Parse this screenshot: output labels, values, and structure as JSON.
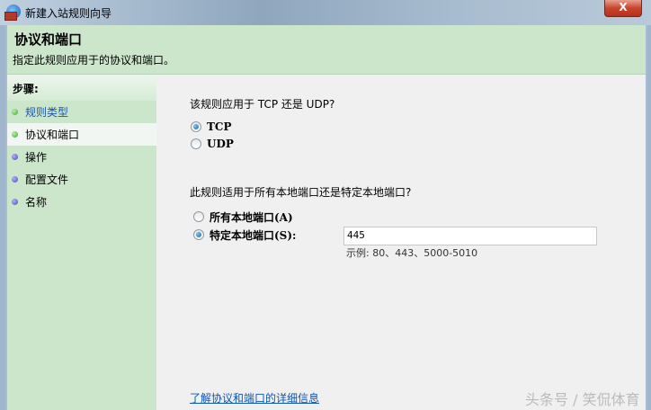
{
  "window": {
    "title": "新建入站规则向导",
    "close_label": "X"
  },
  "header": {
    "title": "协议和端口",
    "subtitle": "指定此规则应用于的协议和端口。"
  },
  "sidebar": {
    "heading": "步骤:",
    "items": [
      {
        "label": "规则类型",
        "state": "done"
      },
      {
        "label": "协议和端口",
        "state": "current"
      },
      {
        "label": "操作"
      },
      {
        "label": "配置文件"
      },
      {
        "label": "名称"
      }
    ]
  },
  "main": {
    "protocol_question": "该规则应用于 TCP 还是 UDP?",
    "protocol_options": [
      {
        "label": "TCP",
        "selected": true
      },
      {
        "label": "UDP",
        "selected": false
      }
    ],
    "port_question": "此规则适用于所有本地端口还是特定本地端口?",
    "port_options": [
      {
        "label": "所有本地端口(A)",
        "selected": false
      },
      {
        "label": "特定本地端口(S):",
        "selected": true
      }
    ],
    "port_value": "445",
    "port_hint": "示例: 80、443、5000-5010",
    "help_link": "了解协议和端口的详细信息"
  },
  "watermark": "头条号 / 笑侃体育"
}
